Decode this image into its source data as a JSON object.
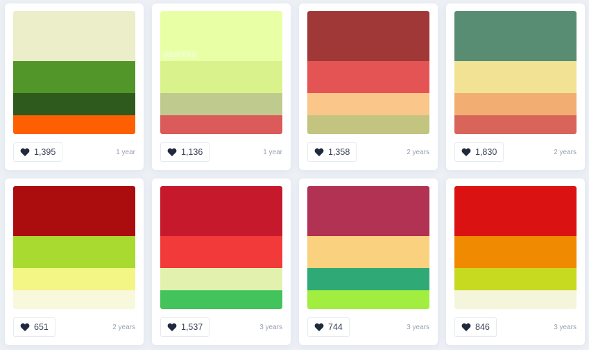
{
  "palettes": [
    {
      "colors": [
        "#ECEDC9",
        "#529528",
        "#2E5A1E",
        "#FF5F03"
      ],
      "likes": "1,395",
      "age": "1 year",
      "hex_label": ""
    },
    {
      "colors": [
        "#E9FFA6",
        "#D9F28C",
        "#BFCB8E",
        "#DB5A5A"
      ],
      "likes": "1,136",
      "age": "1 year",
      "hex_label": "#E9FFA6"
    },
    {
      "colors": [
        "#A03838",
        "#E55454",
        "#FAC68A",
        "#C2C47F"
      ],
      "likes": "1,358",
      "age": "2 years",
      "hex_label": ""
    },
    {
      "colors": [
        "#588C73",
        "#F2E394",
        "#F2AE72",
        "#D96459"
      ],
      "likes": "1,830",
      "age": "2 years",
      "hex_label": ""
    },
    {
      "colors": [
        "#AB0C0D",
        "#A8DA30",
        "#F3F584",
        "#F8F8DD"
      ],
      "likes": "651",
      "age": "2 years",
      "hex_label": ""
    },
    {
      "colors": [
        "#C7192C",
        "#F23A3A",
        "#E2F2AE",
        "#43C35C"
      ],
      "likes": "1,537",
      "age": "3 years",
      "hex_label": ""
    },
    {
      "colors": [
        "#B13252",
        "#FAD17E",
        "#2FAA76",
        "#A2EE40"
      ],
      "likes": "744",
      "age": "3 years",
      "hex_label": ""
    },
    {
      "colors": [
        "#DB1212",
        "#F08A00",
        "#C7DA1F",
        "#F4F5DB"
      ],
      "likes": "846",
      "age": "3 years",
      "hex_label": ""
    }
  ],
  "icons": {
    "like": "heart-icon"
  },
  "colors": {
    "heart": "#1f2b3d",
    "background": "#edf1f6"
  }
}
